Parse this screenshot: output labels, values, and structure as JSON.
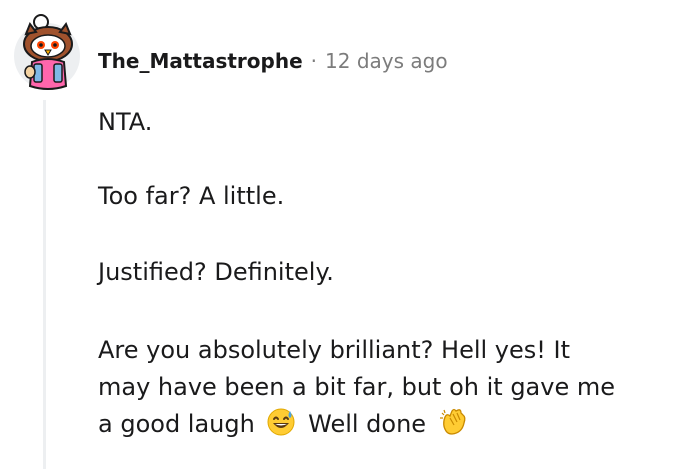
{
  "comment": {
    "username": "The_Mattastrophe",
    "separator": "·",
    "timestamp": "12 days ago",
    "avatar_icon": "snoo-owl-avatar-icon",
    "paragraphs": {
      "p1": "NTA.",
      "p2": "Too far? A little.",
      "p3": "Justified? Definitely.",
      "p4_line1": "Are you absolutely brilliant? Hell yes! It",
      "p4_line2": "may have been a bit far, but oh it gave me",
      "p4_line3_a": "a good laugh",
      "p4_line3_b": "Well done"
    },
    "emojis": {
      "sweat_smile": "grinning-face-with-sweat-emoji",
      "clap": "clapping-hands-emoji"
    }
  }
}
